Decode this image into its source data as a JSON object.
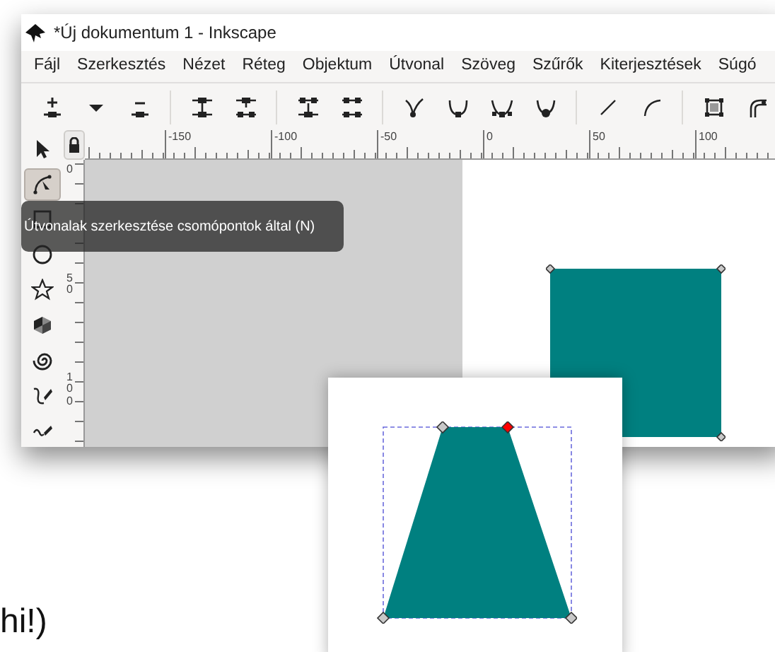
{
  "window": {
    "title": "*Új dokumentum 1 - Inkscape"
  },
  "menu": [
    "Fájl",
    "Szerkesztés",
    "Nézet",
    "Réteg",
    "Objektum",
    "Útvonal",
    "Szöveg",
    "Szűrők",
    "Kiterjesztések",
    "Súgó"
  ],
  "ruler": {
    "horizontal_labels": [
      "-150",
      "-100",
      "-50",
      "0",
      "50",
      "100"
    ],
    "vertical_labels": [
      "0",
      "5",
      "0",
      "1",
      "0",
      "0"
    ]
  },
  "tools": [
    {
      "kind": "selector",
      "selected": false
    },
    {
      "kind": "node",
      "selected": true
    },
    {
      "kind": "rect",
      "selected": false
    },
    {
      "kind": "ellipse",
      "selected": false
    },
    {
      "kind": "star",
      "selected": false
    },
    {
      "kind": "box3d",
      "selected": false
    },
    {
      "kind": "spiral",
      "selected": false
    },
    {
      "kind": "pencil",
      "selected": false
    },
    {
      "kind": "pen",
      "selected": false
    }
  ],
  "tooltip": "Útvonalak szerkesztése csomópontok által (N)",
  "inset_nodes": [
    {
      "selected": false
    },
    {
      "selected": true
    },
    {
      "selected": false
    },
    {
      "selected": false
    }
  ],
  "caption_fragment": "hi!)"
}
